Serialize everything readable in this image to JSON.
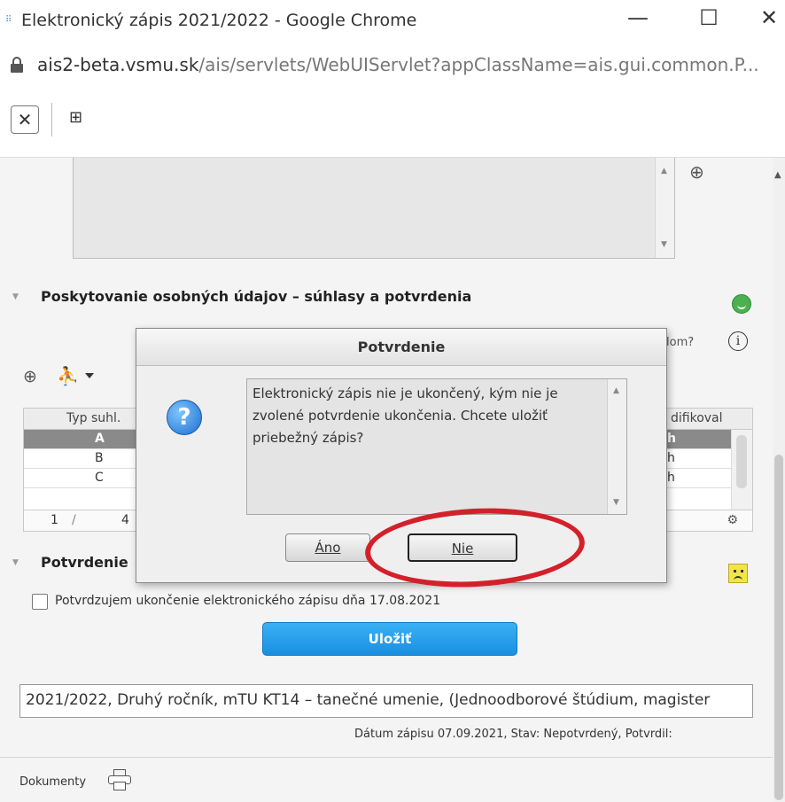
{
  "window": {
    "title": "Elektronický zápis 2021/2022 - Google Chrome",
    "minimize": "—",
    "maximize": "☐",
    "close": "✕"
  },
  "address": {
    "host": "ais2-beta.vsmu.sk",
    "path": "/ais/servlets/WebUIServlet?appClassName=ais.gui.common.P..."
  },
  "toolbar": {
    "close_glyph": "✕",
    "tree_glyph": "⊞"
  },
  "section1": {
    "title": "Poskytovanie osobných údajov – súhlasy a potvrdenia",
    "partial_text": "lom?"
  },
  "table": {
    "header_left": "Typ suhl.",
    "header_right": "difikoval",
    "rows": [
      {
        "value": "A",
        "edge": "h"
      },
      {
        "value": "B",
        "edge": "h"
      },
      {
        "value": "C",
        "edge": "h"
      }
    ],
    "footer": {
      "page": "1",
      "slash": "/",
      "total": "4"
    }
  },
  "section2": {
    "title": "Potvrdenie",
    "checkbox_label": "Potvrdzujem ukončenie elektronického zápisu dňa 17.08.2021",
    "save_label": "Uložiť"
  },
  "study_field": "2021/2022, Druhý ročník, mTU KT14 – tanečné umenie, (Jednoodborové štúdium, magister",
  "zapis_info": "Dátum zápisu 07.09.2021, Stav: Nepotvrdený, Potvrdil:",
  "documents_label": "Dokumenty",
  "dialog": {
    "title": "Potvrdenie",
    "message": "Elektronický zápis nie je ukončený, kým nie je zvolené potvrdenie ukončenia. Chcete uložiť priebežný zápis?",
    "yes_label": "Áno",
    "no_label": "Nie"
  },
  "colors": {
    "save_button": "#1a8fe0",
    "annotation": "#d4202a",
    "ok_status": "#4cb050",
    "warn_status": "#f2e44a"
  }
}
